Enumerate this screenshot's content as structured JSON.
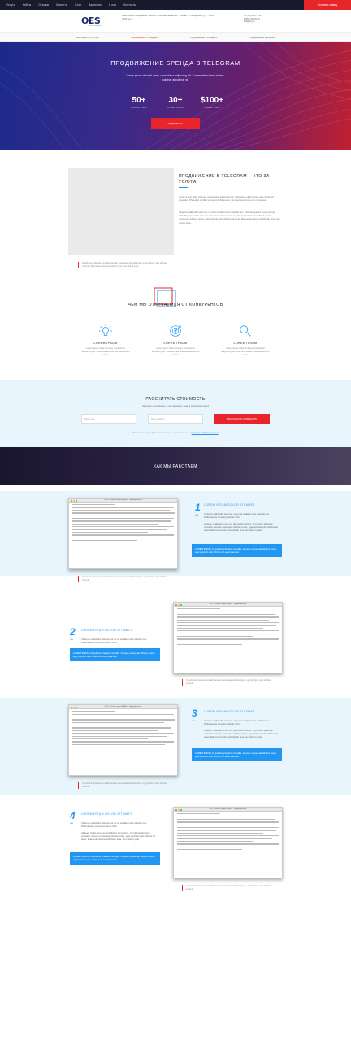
{
  "topnav": {
    "links": [
      "Услуги",
      "Кейсы",
      "Отзывы",
      "Клиенты",
      "Блог",
      "Вакансии",
      "О нас",
      "Контакты"
    ],
    "cta": "Оставить заявку"
  },
  "header": {
    "logo": "OES",
    "logo_sub": "агентство digital",
    "info": "Комплексное продвижение, контекст и интернет-маркетинг · Москва, ул. Складочная, д. 1 · 10:00–19:00 пн–пт",
    "contact": [
      "+7 (495) 255-77-16",
      "8 (800) 505-64-97",
      "info@oes.ru"
    ]
  },
  "subnav": {
    "items": [
      "Все проекты и услуги",
      "Продвижение в Telegram",
      "Продвижение в Instagram",
      "Продвижение Facebook"
    ]
  },
  "hero": {
    "title": "ПРОДВИЖЕНИЕ БРЕНДА В TELEGRAM",
    "desc": "Lorem ipsum dolor sit amet, consectetur adipiscing elit. Suspendisse lorem sapien, pulvinar at pulvinar at.",
    "stats": [
      {
        "num": "50+",
        "label": "LOREM IPSUM"
      },
      {
        "num": "30+",
        "label": "LOREM IPSUM"
      },
      {
        "num": "$100+",
        "label": "LOREM IPSUM"
      }
    ],
    "button": "ПОДРОБНЕЕ"
  },
  "about": {
    "title": "ПРОДВИЖЕНИЕ В TELEGRAM – ЧТО ЗА УСЛУГА",
    "p1": "Lorem ipsum dolor sit amet, consectetur adipiscing elit. Vestibulum ullamcorper vitae dignissim imperdiet. Phasellus porttitor purus a nisi bibendum, sit amet maximus enim consequat.",
    "p2": "Vivamus sollicitudin ante leo, sit amet sodales risus volutpat nec. Pellentesque sit amet pulvinar nibh. Aliquam mattis arcu nec orci dictum fermentum, et pulvinar pharetra convallis. Aenean consequat ultricies turpis, eget pulvinar odio ultricies sit amet. Maecenas lacinia sollicitudin ante, non dictum justo.",
    "caption": "Vestibulum pharetra convallis. Aenean consequat ultricies turpis, eget pulvinar odio ultricies sit amet. Maecenas lacinia sollicitudin ante, non dictum justo."
  },
  "features": {
    "title": "ЧЕМ МЫ ОТЛИЧАЕМСЯ ОТ КОНКУРЕНТОВ",
    "items": [
      {
        "icon": "lightbulb-icon",
        "title": "LOREM IPSUM",
        "desc": "Lorem ipsum dolor sit amet, consectetur adipiscing elit. Nulla ultricies ante sed elementum cursus."
      },
      {
        "icon": "target-icon",
        "title": "LOREM IPSUM",
        "desc": "Lorem ipsum dolor sit amet, consectetur adipiscing elit. Nulla ultricies ante sed elementum cursus."
      },
      {
        "icon": "magnifier-icon",
        "title": "LOREM IPSUM",
        "desc": "Lorem ipsum dolor sit amet, consectetur adipiscing elit. Nulla ultricies ante sed elementum cursus."
      }
    ]
  },
  "calc": {
    "title": "РАССЧИТАТЬ СТОИМОСТЬ",
    "sub": "Заполните поля формы, и мы свяжемся с вами в ближайшее время",
    "name_placeholder": "Ваше имя",
    "phone_placeholder": "Ваш телефон",
    "button": "РАССЧИТАТЬ СТОИМОСТЬ",
    "note": "Нажимая на кнопку «Рассчитать стоимость», вы соглашаетесь с",
    "note_link": "условиями обработки данных"
  },
  "how": {
    "title": "КАК МЫ РАБОТАЕМ"
  },
  "steps": [
    {
      "num": "1",
      "word": "шаг",
      "title": "LOREM IPSUM DOLOR SIT AMET",
      "p1": "Vivamus sollicitudin ante leo, sit a met sodales risus volutpat nec. Pellentesque sit amet pulvinar nibh.",
      "p2": "Aliquam mattis arcu nec orci dictum fermentum. Ut pulvinar pharetra convallis. Aenean consequat ultricies turpis, eget pulvinar odio ultricies sit amet. Maecenas lacinia sollicitudin ante, non dictum justo.",
      "box": "LOREM IPSUM, Ut pulvinar pharetra convallis. Aenean consequat ultricies turpis, eget pulvinar odio ultricies sit amet placerat.",
      "window_title": "ООО «Стиль» и отдел ВИДЕО – Предварительно",
      "caption": "Ut pulvinar pharetra convallis. Aenean consequat ultricies turpis, eget pulvinar odio ultricies sit amet."
    },
    {
      "num": "2",
      "word": "шаг",
      "title": "LOREM IPSUM DOLOR SIT AMET",
      "p1": "Vivamus sollicitudin ante leo, sit a met sodales risus volutpat nec. Pellentesque sit amet pulvinar nibh.",
      "p2": "Aliquam mattis arcu nec orci dictum fermentum. Ut pulvinar pharetra convallis. Aenean consequat ultricies turpis, eget pulvinar odio ultricies sit amet. Maecenas lacinia sollicitudin ante, non dictum justo.",
      "box": "LOREM IPSUM, Ut pulvinar pharetra convallis. Aenean consequat ultricies turpis, eget pulvinar odio ultricies sit amet placerat.",
      "window_title": "ООО «Стиль» и отдел ВИДЕО – Предварительно",
      "caption": "Ut pulvinar pharetra convallis. Aenean consequat ultricies turpis, eget pulvinar odio ultricies sit amet."
    },
    {
      "num": "3",
      "word": "шаг",
      "title": "LOREM IPSUM DOLOR SIT AMET",
      "p1": "Vivamus sollicitudin ante leo, sit a met sodales risus volutpat nec. Pellentesque sit amet pulvinar nibh.",
      "p2": "Aliquam mattis arcu nec orci dictum fermentum. Ut pulvinar pharetra convallis. Aenean consequat ultricies turpis, eget pulvinar odio ultricies sit amet. Maecenas lacinia sollicitudin ante, non dictum justo.",
      "box": "LOREM IPSUM, Ut pulvinar pharetra convallis. Aenean consequat ultricies turpis, eget pulvinar odio ultricies sit amet placerat.",
      "window_title": "ООО «Стиль» и отдел ВИДЕО – Предварительно",
      "caption": "Ut pulvinar pharetra convallis. Aenean consequat ultricies turpis, eget pulvinar odio ultricies sit amet."
    },
    {
      "num": "4",
      "word": "шаг",
      "title": "LOREM IPSUM DOLOR SIT AMET",
      "p1": "Vivamus sollicitudin ante leo, sit a met sodales risus volutpat nec. Pellentesque sit amet pulvinar nibh.",
      "p2": "Aliquam mattis arcu nec orci dictum fermentum. Ut pulvinar pharetra convallis. Aenean consequat ultricies turpis, eget pulvinar odio ultricies sit amet. Maecenas lacinia sollicitudin ante, non dictum justo.",
      "box": "LOREM IPSUM, Ut pulvinar pharetra convallis. Aenean consequat ultricies turpis, eget pulvinar odio ultricies sit amet placerat.",
      "window_title": "ООО «Стиль» и отдел ВИДЕО – Предварительно",
      "caption": "Ut pulvinar pharetra convallis. Aenean consequat ultricies turpis, eget pulvinar odio ultricies sit amet."
    }
  ],
  "colors": {
    "accent": "#e8252b",
    "blue": "#2196f3",
    "dark": "#1a1a2e"
  }
}
